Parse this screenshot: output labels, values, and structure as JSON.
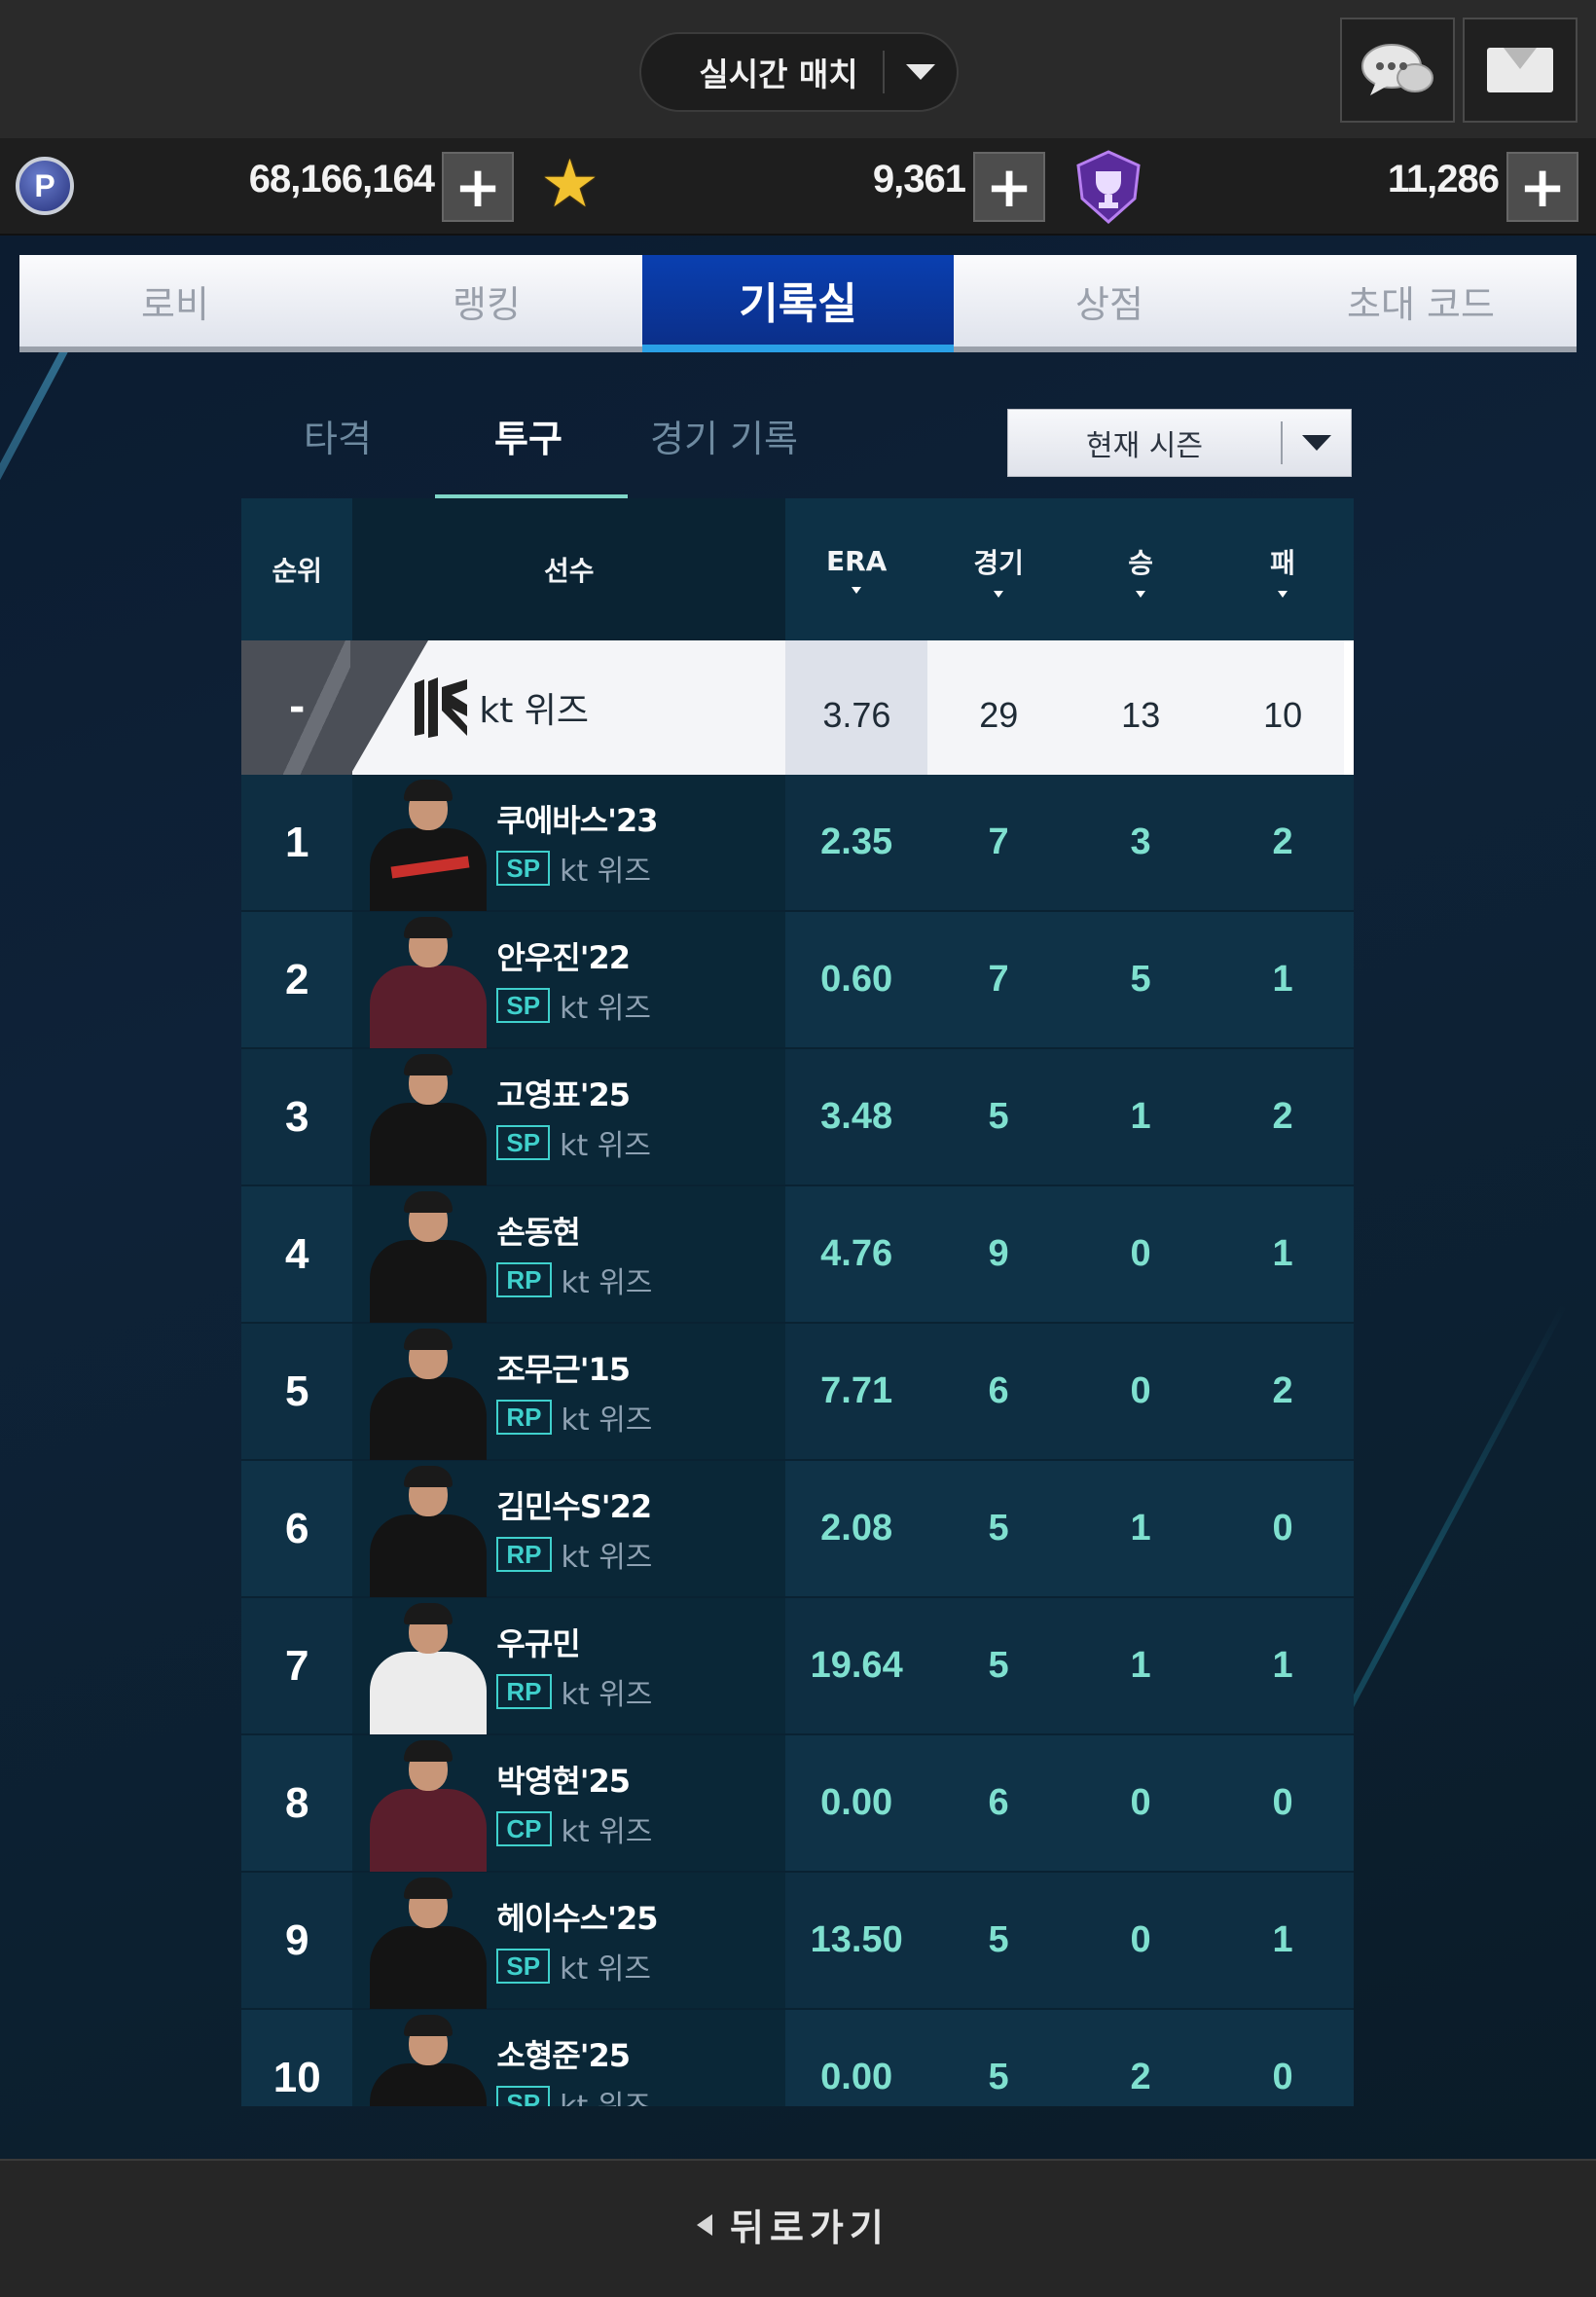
{
  "header": {
    "match_label": "실시간 매치",
    "chat_icon": "chat-bubbles-icon",
    "mail_icon": "envelope-icon"
  },
  "currency": [
    {
      "icon": "p-coin-icon",
      "amount": "68,166,164"
    },
    {
      "icon": "star-icon",
      "amount": "9,361"
    },
    {
      "icon": "trophy-badge-icon",
      "amount": "11,286"
    }
  ],
  "main_tabs": [
    {
      "label": "로비",
      "active": false
    },
    {
      "label": "랭킹",
      "active": false
    },
    {
      "label": "기록실",
      "active": true
    },
    {
      "label": "상점",
      "active": false
    },
    {
      "label": "초대 코드",
      "active": false
    }
  ],
  "sub_tabs": [
    {
      "label": "타격",
      "active": false
    },
    {
      "label": "투구",
      "active": true
    },
    {
      "label": "경기 기록",
      "active": false
    }
  ],
  "season_select": {
    "value": "현재 시즌"
  },
  "table": {
    "headers": {
      "rank": "순위",
      "player": "선수",
      "era": "ERA",
      "games": "경기",
      "wins": "승",
      "losses": "패"
    },
    "team_row": {
      "rank": "-",
      "team": "kt 위즈",
      "era": "3.76",
      "games": "29",
      "wins": "13",
      "losses": "10"
    },
    "rows": [
      {
        "rank": "1",
        "name": "쿠에바스'23",
        "pos": "SP",
        "team": "kt 위즈",
        "era": "2.35",
        "games": "7",
        "wins": "3",
        "losses": "2"
      },
      {
        "rank": "2",
        "name": "안우진'22",
        "pos": "SP",
        "team": "kt 위즈",
        "era": "0.60",
        "games": "7",
        "wins": "5",
        "losses": "1"
      },
      {
        "rank": "3",
        "name": "고영표'25",
        "pos": "SP",
        "team": "kt 위즈",
        "era": "3.48",
        "games": "5",
        "wins": "1",
        "losses": "2"
      },
      {
        "rank": "4",
        "name": "손동현",
        "pos": "RP",
        "team": "kt 위즈",
        "era": "4.76",
        "games": "9",
        "wins": "0",
        "losses": "1"
      },
      {
        "rank": "5",
        "name": "조무근'15",
        "pos": "RP",
        "team": "kt 위즈",
        "era": "7.71",
        "games": "6",
        "wins": "0",
        "losses": "2"
      },
      {
        "rank": "6",
        "name": "김민수S'22",
        "pos": "RP",
        "team": "kt 위즈",
        "era": "2.08",
        "games": "5",
        "wins": "1",
        "losses": "0"
      },
      {
        "rank": "7",
        "name": "우규민",
        "pos": "RP",
        "team": "kt 위즈",
        "era": "19.64",
        "games": "5",
        "wins": "1",
        "losses": "1"
      },
      {
        "rank": "8",
        "name": "박영현'25",
        "pos": "CP",
        "team": "kt 위즈",
        "era": "0.00",
        "games": "6",
        "wins": "0",
        "losses": "0"
      },
      {
        "rank": "9",
        "name": "헤이수스'25",
        "pos": "SP",
        "team": "kt 위즈",
        "era": "13.50",
        "games": "5",
        "wins": "0",
        "losses": "1"
      },
      {
        "rank": "10",
        "name": "소형준'25",
        "pos": "SP",
        "team": "kt 위즈",
        "era": "0.00",
        "games": "5",
        "wins": "2",
        "losses": "0"
      }
    ]
  },
  "footer": {
    "back_label": "뒤로가기",
    "back_icon": "back-arrow-icon"
  },
  "colors": {
    "accent": "#0b3fb0",
    "stat_text": "#7fe0cf",
    "position_badge": "#3fd0cc"
  }
}
